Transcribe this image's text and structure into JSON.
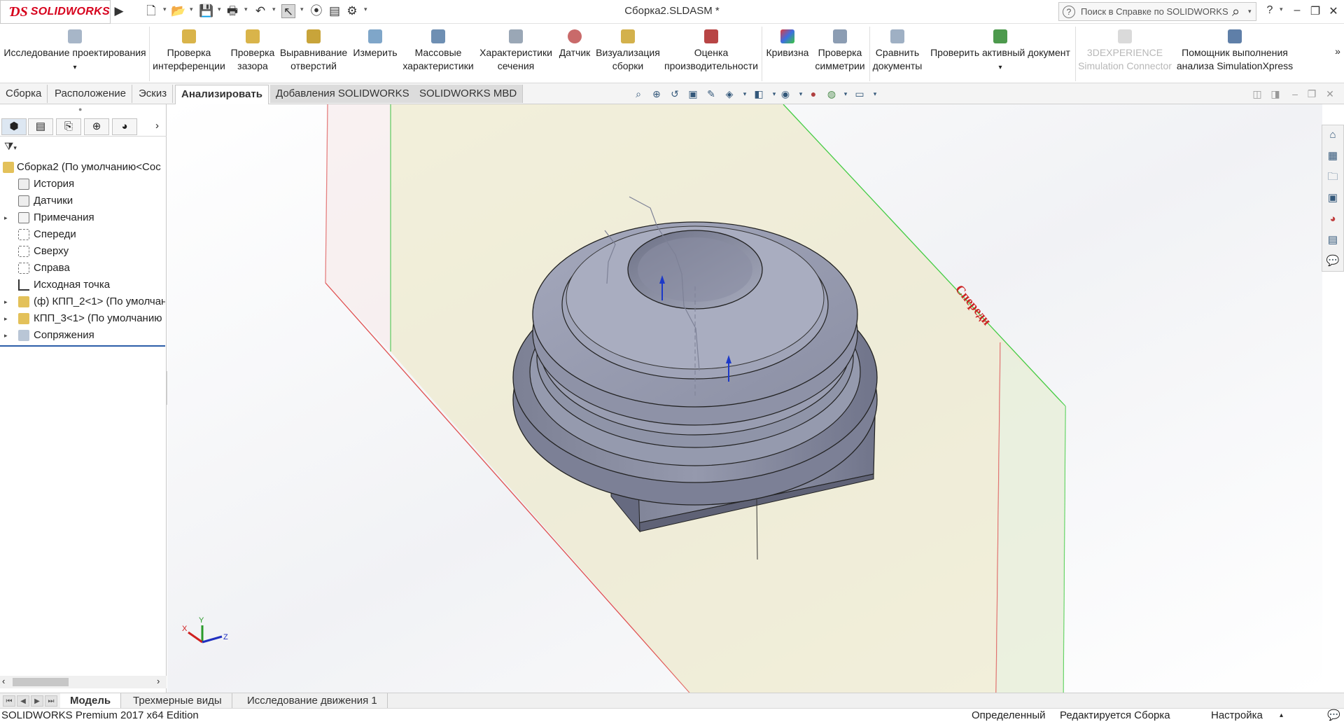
{
  "app": {
    "brand": "SOLIDWORKS",
    "document_title": "Сборка2.SLDASM *",
    "help_search_placeholder": "Поиск в Справке по SOLIDWORKS"
  },
  "ribbon": {
    "items": [
      {
        "line1": "Исследование проектирования",
        "line2": ""
      },
      {
        "line1": "Проверка",
        "line2": "интерференции"
      },
      {
        "line1": "Проверка",
        "line2": "зазора"
      },
      {
        "line1": "Выравнивание",
        "line2": "отверстий"
      },
      {
        "line1": "Измерить",
        "line2": ""
      },
      {
        "line1": "Массовые",
        "line2": "характеристики"
      },
      {
        "line1": "Характеристики",
        "line2": "сечения"
      },
      {
        "line1": "Датчик",
        "line2": ""
      },
      {
        "line1": "Визуализация",
        "line2": "сборки"
      },
      {
        "line1": "Оценка",
        "line2": "производительности"
      },
      {
        "line1": "Кривизна",
        "line2": ""
      },
      {
        "line1": "Проверка",
        "line2": "симметрии"
      },
      {
        "line1": "Сравнить",
        "line2": "документы"
      },
      {
        "line1": "Проверить активный документ",
        "line2": ""
      },
      {
        "line1": "3DEXPERIENCE",
        "line2": "Simulation Connector"
      },
      {
        "line1": "Помощник выполнения",
        "line2": "анализа SimulationXpress"
      }
    ]
  },
  "tabs": [
    "Сборка",
    "Расположение",
    "Эскиз",
    "Анализировать",
    "Добавления SOLIDWORKS",
    "SOLIDWORKS MBD"
  ],
  "tree": {
    "items": [
      {
        "label": "Сборка2  (По умолчанию<Сос",
        "expander": ""
      },
      {
        "label": "История",
        "expander": ""
      },
      {
        "label": "Датчики",
        "expander": ""
      },
      {
        "label": "Примечания",
        "expander": "▸"
      },
      {
        "label": "Спереди",
        "expander": ""
      },
      {
        "label": "Сверху",
        "expander": ""
      },
      {
        "label": "Справа",
        "expander": ""
      },
      {
        "label": "Исходная точка",
        "expander": ""
      },
      {
        "label": "(ф) КПП_2<1> (По умолчан",
        "expander": "▸"
      },
      {
        "label": "КПП_3<1> (По умолчанию",
        "expander": "▸"
      },
      {
        "label": "Сопряжения",
        "expander": "▸"
      }
    ]
  },
  "viewport": {
    "plane_label": "Спереди",
    "triad": {
      "x": "X",
      "y": "Y",
      "z": "Z"
    }
  },
  "bottom_tabs": [
    "Модель",
    "Трехмерные виды",
    "Исследование движения 1"
  ],
  "status": {
    "edition": "SOLIDWORKS Premium 2017 x64 Edition",
    "defined": "Определенный",
    "editing": "Редактируется Сборка",
    "settings": "Настройка"
  },
  "colors": {
    "brand_red": "#d6001c",
    "part_body": "#8d92a8",
    "plane_fill": "#ece8c8",
    "plane_red_edge": "#e05050",
    "plane_green_edge": "#44cc44",
    "selection_blue": "#2c5ea8"
  }
}
